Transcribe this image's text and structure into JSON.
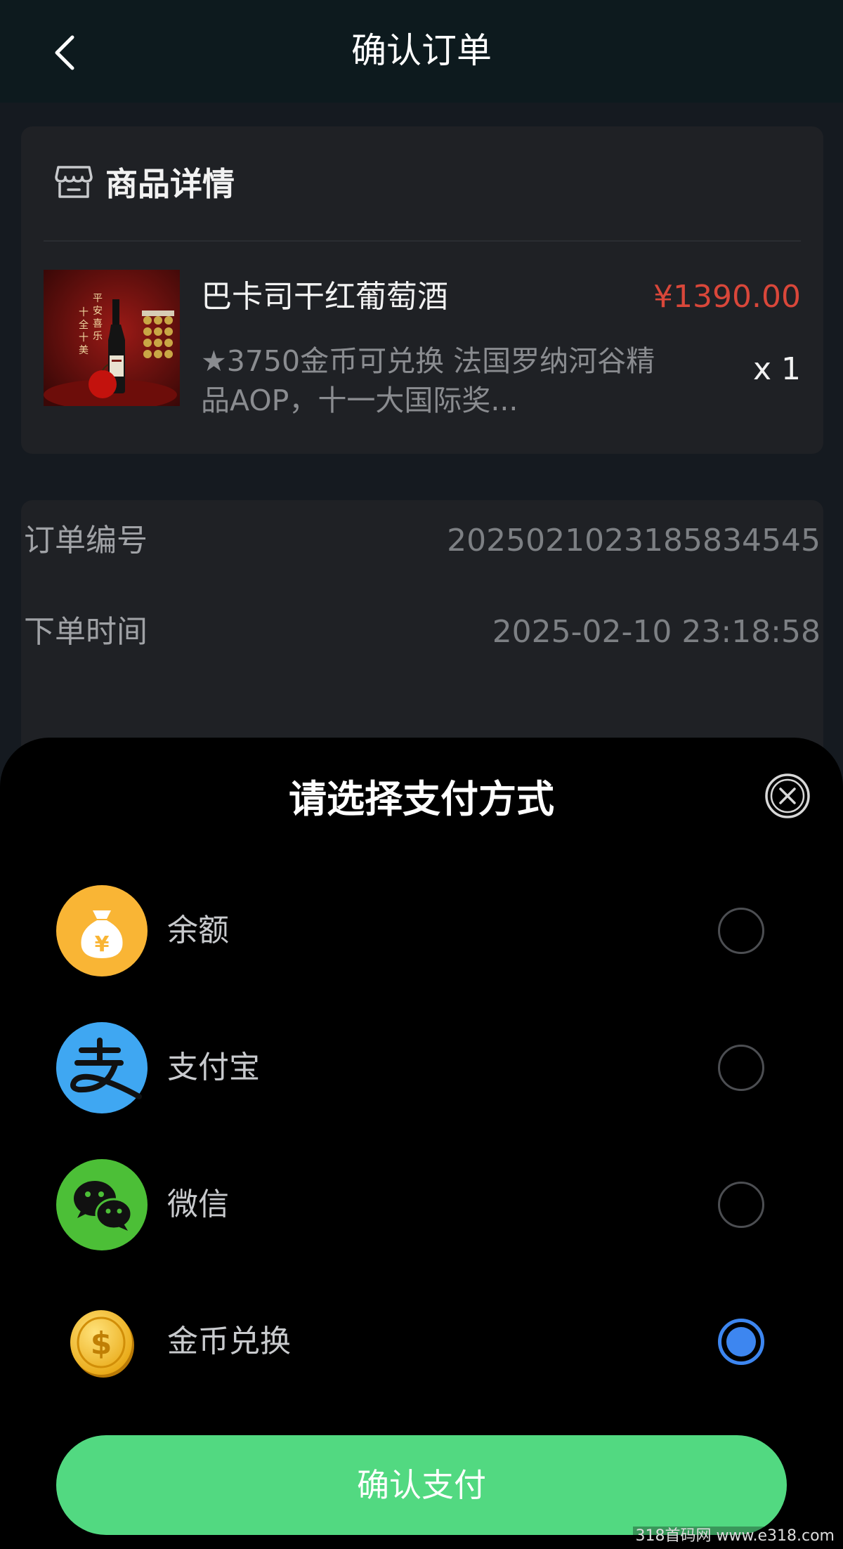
{
  "header": {
    "title": "确认订单"
  },
  "product_section": {
    "title": "商品详情",
    "product": {
      "name": "巴卡司干红葡萄酒",
      "price": "¥1390.00",
      "description": "★3750金币可兑换 法国罗纳河谷精品AOP，十一大国际奖...",
      "quantity": "x  1",
      "image_text": "平安喜乐 十全十美"
    }
  },
  "order_info": {
    "order_no_label": "订单编号",
    "order_no_value": "2025021023185834545",
    "order_time_label": "下单时间",
    "order_time_value": "2025-02-10 23:18:58"
  },
  "payment_sheet": {
    "title": "请选择支付方式",
    "options": [
      {
        "label": "余额",
        "icon": "money-bag-icon",
        "selected": false
      },
      {
        "label": "支付宝",
        "icon": "alipay-icon",
        "selected": false
      },
      {
        "label": "微信",
        "icon": "wechat-icon",
        "selected": false
      },
      {
        "label": "金币兑换",
        "icon": "gold-coin-icon",
        "selected": true
      }
    ],
    "confirm_label": "确认支付"
  },
  "watermark": "318首码网 www.e318.com",
  "colors": {
    "price_red": "#d9473a",
    "confirm_green": "#52d981",
    "radio_blue": "#3d86f0",
    "balance_orange": "#f9b535",
    "alipay_blue": "#3fa7f2",
    "wechat_green": "#4cbf37"
  }
}
